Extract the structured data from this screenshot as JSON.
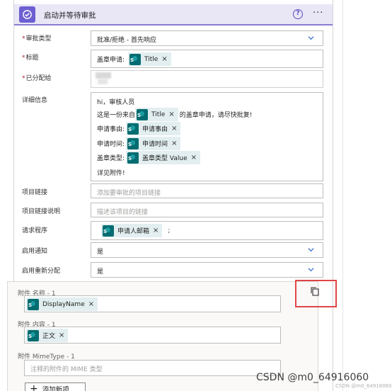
{
  "header": {
    "title": "启动并等待审批",
    "help_glyph": "?",
    "more_glyph": "···",
    "accent_color": "#6c5fd1"
  },
  "fields": {
    "approval_type": {
      "label": "审批类型",
      "value": "批准/拒绝 - 首先响应"
    },
    "title": {
      "label": "标题",
      "prefix": "盖章申请:",
      "token": "Title"
    },
    "assigned_to": {
      "label": "已分配给"
    },
    "details": {
      "label": "详细信息",
      "line1": "hi，审核人员",
      "line2_pre": "这是一份来自",
      "line2_token": "Title",
      "line2_post": "的盖章申请，请尽快批复!",
      "line3_pre": "申请事由:",
      "line3_token": "申请事由",
      "line4_pre": "申请时间:",
      "line4_token": "申请时间",
      "line5_pre": "盖章类型:",
      "line5_token": "盖章类型 Value",
      "line6": "详见附件!"
    },
    "item_link": {
      "label": "项目链接",
      "placeholder": "添加要审批的项目链接"
    },
    "item_link_desc": {
      "label": "项目链接说明",
      "placeholder": "描述该项目的链接"
    },
    "requestor": {
      "label": "请求程序",
      "token": "申请人邮箱",
      "suffix": ";"
    },
    "enable_notifications": {
      "label": "启用通知",
      "value": "是"
    },
    "enable_reassignment": {
      "label": "启用重新分配",
      "value": "是"
    }
  },
  "attachments": {
    "name_label": "附件 名称 - 1",
    "name_token": "DisplayName",
    "content_label": "附件 内容 - 1",
    "content_token": "正文",
    "mime_label": "附件 MimeType - 1",
    "mime_placeholder": "注释的附件的 MIME 类型",
    "add_label": "添加新项",
    "highlight_color": "#e04545"
  },
  "token_close": "×",
  "required_mark": "*",
  "watermark": "CSDN @m0_64916060",
  "watermark_small": "CSDN @m0_64916060"
}
